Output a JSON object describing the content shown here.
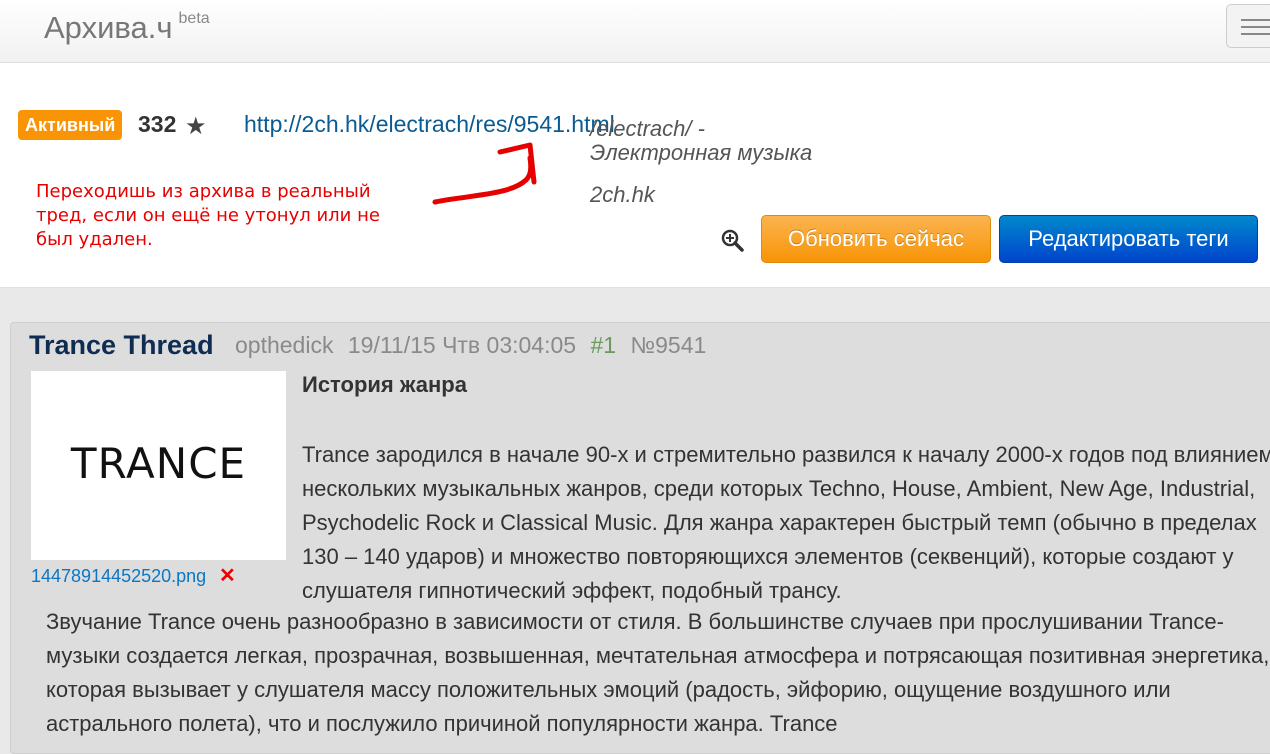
{
  "navbar": {
    "brand": "Архива.ч",
    "brand_tag": "beta"
  },
  "thread_info": {
    "status_badge": "Активный",
    "count": "332",
    "url": "http://2ch.hk/electrach/res/9541.html",
    "board_name": "/electrach/ - Электронная музыка",
    "board_host": "2ch.hk",
    "annotation": "Переходишь из архива в реальный тред, если он ещё не утонул или не был удален.",
    "refresh_label": "Обновить сейчас",
    "edit_tags_label": "Редактировать теги"
  },
  "post": {
    "subject": "Trance Thread",
    "author": "opthedick",
    "datetime": "19/11/15 Чтв 03:04:05",
    "index": "#1",
    "number": "№9541",
    "thumbnail_text": "TRANCE",
    "file_name": "14478914452520.png",
    "delete_mark": "✕",
    "title": "История жанра",
    "paragraph1": "Trance зародился в начале 90-х и стремительно развился к началу 2000-х годов под влиянием нескольких музыкальных жанров, среди которых Techno, House, Ambient, New Age, Industrial, Psychodelic Rock и Classical Music. Для жанра характерен быстрый темп (обычно в пределах 130 – 140 ударов) и множество повторяющихся элементов (секвенций), которые создают у слушателя гипнотический эффект, подобный трансу.",
    "paragraph2": "Звучание Trance очень разнообразно в зависимости от стиля. В большинстве случаев при прослушивании Trance-музыки создается легкая, прозрачная, возвышенная, мечтательная атмосфера и потрясающая позитивная энергетика, которая вызывает у слушателя массу положительных эмоций (радость, эйфорию, ощущение воздушного или астрального полета), что и послужило причиной популярности жанра. Trance"
  },
  "colors": {
    "badge": "#f89406",
    "refresh_button": "#f89406",
    "edit_button": "#0044cc",
    "annotation": "#e60000",
    "link": "#0b5b93"
  },
  "icons": [
    "menu-icon",
    "star-icon",
    "zoom-icon",
    "red-arrow-annotation"
  ]
}
